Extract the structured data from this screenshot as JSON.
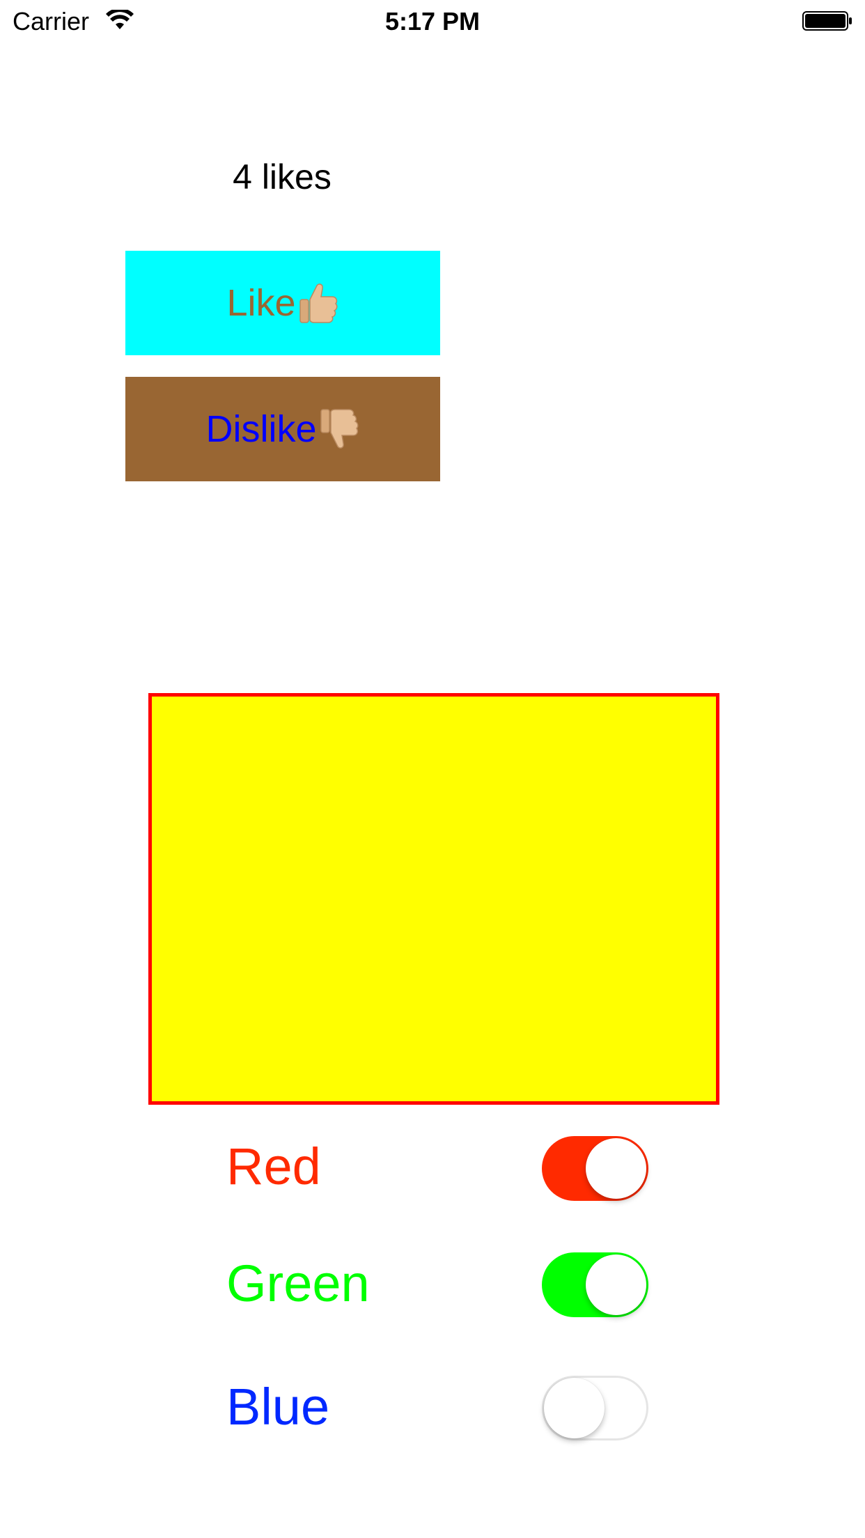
{
  "status_bar": {
    "carrier": "Carrier",
    "time": "5:17 PM",
    "wifi_icon": "wifi-icon",
    "battery_icon": "battery-icon"
  },
  "likes": {
    "count_label": "4 likes",
    "like_button_label": "Like",
    "like_icon": "thumbs-up-icon",
    "dislike_button_label": "Dislike",
    "dislike_icon": "thumbs-down-icon"
  },
  "colors": {
    "like_bg": "#00ffff",
    "like_text": "#996633",
    "dislike_bg": "#996633",
    "dislike_text": "#0000ff",
    "box_fill": "#ffff00",
    "box_border": "#ff0000"
  },
  "switches": [
    {
      "label": "Red",
      "color": "#ff2a00",
      "on": true
    },
    {
      "label": "Green",
      "color": "#00ff00",
      "on": true
    },
    {
      "label": "Blue",
      "color": "#0028ff",
      "on": false
    }
  ]
}
